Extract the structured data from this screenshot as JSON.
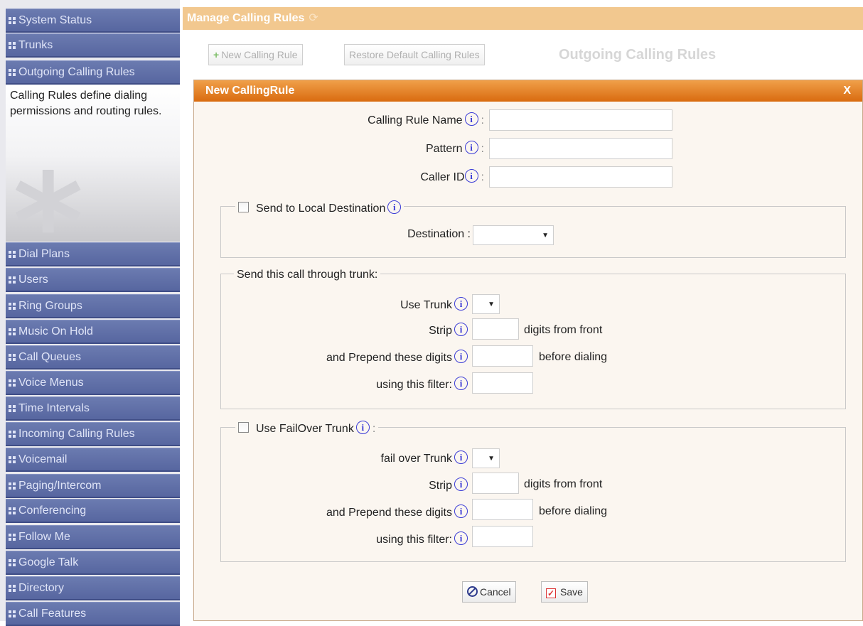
{
  "sidebar": {
    "top_items": [
      "System Status",
      "Trunks",
      "Outgoing Calling Rules"
    ],
    "help_text": "Calling Rules define dialing permissions and routing rules.",
    "bottom_items": [
      "Dial Plans",
      "Users",
      "Ring Groups",
      "Music On Hold",
      "Call Queues",
      "Voice Menus",
      "Time Intervals",
      "Incoming Calling Rules",
      "Voicemail",
      "Paging/Intercom",
      "Conferencing",
      "Follow Me",
      "Google Talk",
      "Directory",
      "Call Features"
    ]
  },
  "header": {
    "title": "Manage Calling Rules",
    "refresh_icon": "refresh-icon"
  },
  "toolbar": {
    "new_rule_label": "New Calling Rule",
    "restore_label": "Restore Default Calling Rules",
    "section_title": "Outgoing Calling Rules"
  },
  "dialog": {
    "title": "New CallingRule",
    "close_label": "X",
    "fields": {
      "name_label": "Calling Rule Name",
      "pattern_label": "Pattern",
      "callerid_label": "Caller ID",
      "name_value": "",
      "pattern_value": "",
      "callerid_value": ""
    },
    "local_dest": {
      "legend": "Send to Local Destination",
      "checked": false,
      "destination_label": "Destination :",
      "destination_value": ""
    },
    "trunk": {
      "legend": "Send this call through trunk:",
      "use_trunk_label": "Use Trunk",
      "strip_label": "Strip",
      "strip_after": "digits from front",
      "prepend_label": "and Prepend these digits",
      "prepend_after": "before dialing",
      "filter_label": "using this filter:"
    },
    "failover": {
      "legend": "Use FailOver Trunk",
      "checked": false,
      "trunk_label": "fail over Trunk",
      "strip_label": "Strip",
      "strip_after": "digits from front",
      "prepend_label": "and Prepend these digits",
      "prepend_after": "before dialing",
      "filter_label": "using this filter:"
    },
    "cancel_label": "Cancel",
    "save_label": "Save"
  },
  "colors": {
    "header_bg": "#f2c88f",
    "dialog_titlebar": "#e07d20",
    "nav_bg": "#6270a8",
    "info_icon": "#3a3ad6"
  }
}
